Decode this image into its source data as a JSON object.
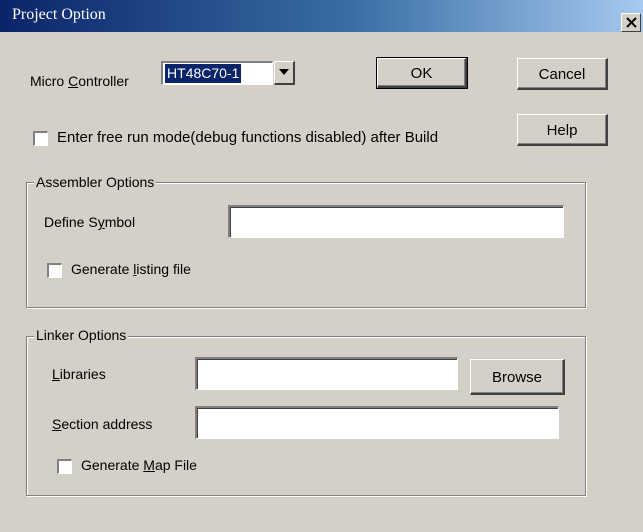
{
  "window": {
    "title": "Project Option",
    "close_glyph": "×"
  },
  "micro_controller": {
    "label_pre": "Micro ",
    "label_u": "C",
    "label_post": "ontroller",
    "value": "HT48C70-1"
  },
  "buttons": {
    "ok": "OK",
    "cancel": "Cancel",
    "help": "Help"
  },
  "free_run": {
    "label": "Enter free run mode(debug functions disabled) after Build",
    "checked": false
  },
  "assembler": {
    "legend": "Assembler Options",
    "define_symbol_pre": "Define S",
    "define_symbol_u": "y",
    "define_symbol_post": "mbol",
    "define_symbol_value": "",
    "listing_pre": "Generate ",
    "listing_u": "l",
    "listing_post": "isting file",
    "listing_checked": false
  },
  "linker": {
    "legend": "Linker Options",
    "libraries_u": "L",
    "libraries_post": "ibraries",
    "libraries_value": "",
    "browse": "Browse",
    "section_u": "S",
    "section_post": "ection address",
    "section_value": "",
    "map_pre": "Generate ",
    "map_u": "M",
    "map_post": "ap File",
    "map_checked": false
  }
}
